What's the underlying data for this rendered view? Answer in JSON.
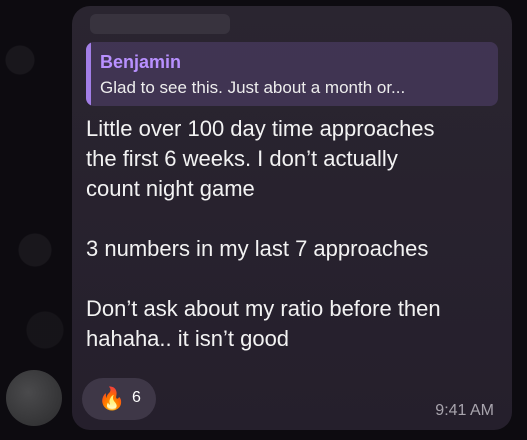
{
  "reply": {
    "author": "Benjamin",
    "text": "Glad to see this. Just about a month or..."
  },
  "message": {
    "line1": "Little over 100 day time approaches",
    "line2": "the first 6 weeks. I don’t actually",
    "line3": "count night game",
    "line4": "3 numbers in my last 7 approaches",
    "line5": "Don’t ask about my ratio before then",
    "line6": "hahaha.. it isn’t good"
  },
  "reaction": {
    "emoji": "🔥",
    "count": "6"
  },
  "time": "9:41 AM",
  "colors": {
    "accent": "#b890ff",
    "bubble": "#2a2530",
    "background": "#0d0b10"
  }
}
